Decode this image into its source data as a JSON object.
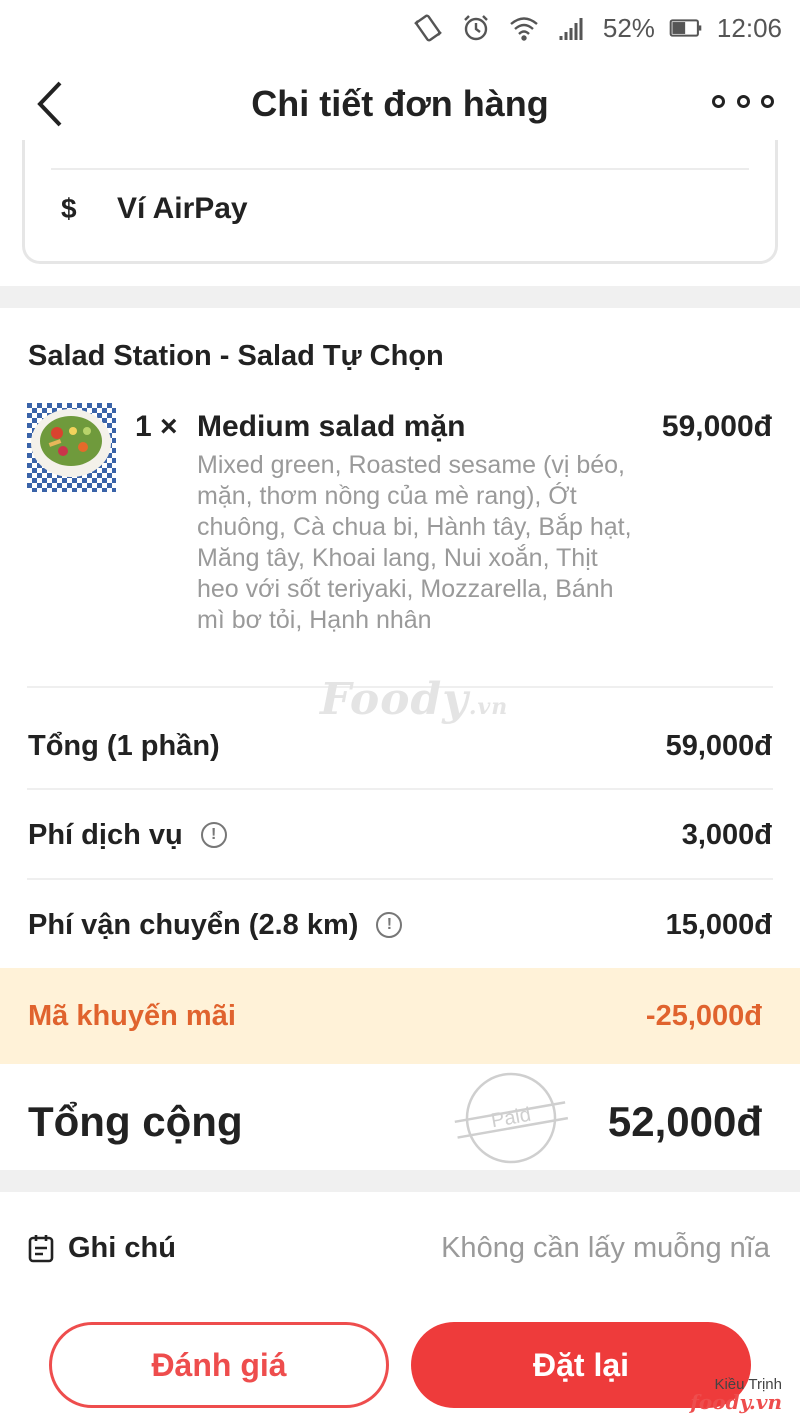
{
  "status_bar": {
    "battery": "52%",
    "time": "12:06"
  },
  "header": {
    "title": "Chi tiết đơn hàng"
  },
  "payment": {
    "method": "Ví AirPay"
  },
  "order": {
    "shop": "Salad Station - Salad Tự Chọn",
    "item": {
      "qty": "1 ×",
      "name": "Medium salad mặn",
      "price": "59,000đ",
      "description": "Mixed green, Roasted sesame (vị béo, mặn, thơm nồng của mè rang), Ớt chuông, Cà chua bi, Hành tây, Bắp hạt, Măng tây, Khoai lang, Nui xoắn, Thịt heo với sốt teriyaki, Mozzarella, Bánh mì bơ tỏi, Hạnh nhân"
    }
  },
  "summary": {
    "subtotal_label": "Tổng (1 phần)",
    "subtotal_value": "59,000đ",
    "service_label": "Phí dịch vụ",
    "service_value": "3,000đ",
    "shipping_label": "Phí vận chuyển (2.8 km)",
    "shipping_value": "15,000đ",
    "promo_label": "Mã khuyến mãi",
    "promo_value": "-25,000đ",
    "total_label": "Tổng cộng",
    "total_value": "52,000đ",
    "paid_stamp": "Paid"
  },
  "note": {
    "label": "Ghi chú",
    "value": "Không cần lấy muỗng nĩa"
  },
  "actions": {
    "review": "Đánh giá",
    "reorder": "Đặt lại"
  },
  "watermarks": {
    "center_main": "Foody",
    "center_suffix": ".vn",
    "corner_author": "Kiều Trịnh",
    "corner_brand": "foody.vn"
  },
  "colors": {
    "accent": "#ee4d4d",
    "promo_text": "#e0632e",
    "promo_bg": "#fff2d8"
  }
}
